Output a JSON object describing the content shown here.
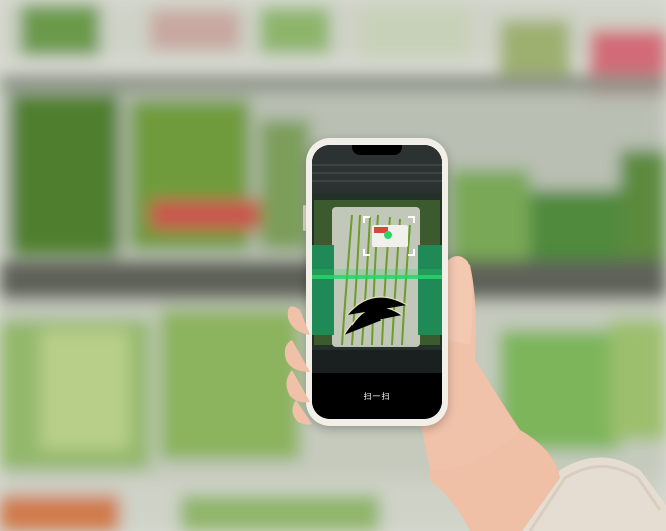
{
  "scene": {
    "description_label": "",
    "phone": {
      "scan_label": "扫一扫"
    },
    "colors": {
      "shelf_blur": "#a9ad9f",
      "scan_line": "#2bd36b",
      "phone_frame": "#f2efe9",
      "skin": "#f1c2aa",
      "sleeve": "#e6ddd2"
    }
  }
}
